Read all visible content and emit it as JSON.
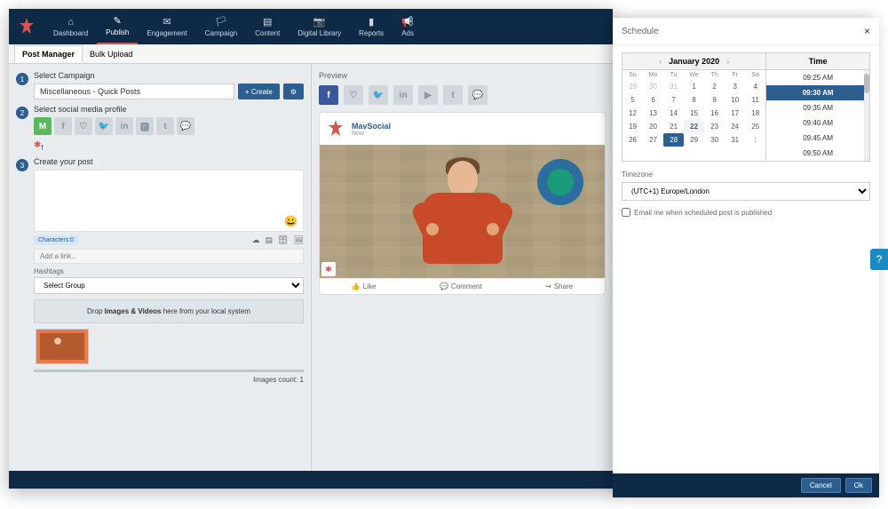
{
  "topnav": [
    {
      "label": "Dashboard",
      "icon": "⌂"
    },
    {
      "label": "Publish",
      "icon": "✎",
      "active": true
    },
    {
      "label": "Engagement",
      "icon": "✉"
    },
    {
      "label": "Campaign",
      "icon": "🏳"
    },
    {
      "label": "Content",
      "icon": "▤"
    },
    {
      "label": "Digital Library",
      "icon": "📷"
    },
    {
      "label": "Reports",
      "icon": "▮"
    },
    {
      "label": "Ads",
      "icon": "📢"
    }
  ],
  "subtabs": {
    "manager": "Post Manager",
    "bulk": "Bulk Upload"
  },
  "steps": {
    "s1": {
      "num": "1",
      "label": "Select Campaign",
      "value": "Miscellaneous - Quick Posts",
      "create": "+ Create"
    },
    "s2": {
      "num": "2",
      "label": "Select social media profile",
      "icons": [
        "M",
        "f",
        "♡",
        "🐦",
        "in",
        "🅿",
        "t",
        "💬"
      ]
    },
    "s3": {
      "num": "3",
      "label": "Create your post"
    }
  },
  "editor": {
    "chars": "Characters:0",
    "link_ph": "Add a link..",
    "hashtags": "Hashtags",
    "group": "Select Group"
  },
  "dropzone": {
    "pre": "Drop ",
    "bold": "Images & Videos",
    "post": " here from your local system"
  },
  "images_count": "Images count: 1",
  "preview": {
    "title": "Preview",
    "author": "MavSocial",
    "time": "Now",
    "like": "Like",
    "comment": "Comment",
    "share": "Share"
  },
  "scheduler": {
    "title": "Schedule",
    "month": "January 2020",
    "dow": [
      "Su",
      "Mo",
      "Tu",
      "We",
      "Th",
      "Fr",
      "Sa"
    ],
    "cal": [
      [
        {
          "d": "29",
          "o": 1
        },
        {
          "d": "30",
          "o": 1
        },
        {
          "d": "31",
          "o": 1
        },
        {
          "d": "1"
        },
        {
          "d": "2"
        },
        {
          "d": "3"
        },
        {
          "d": "4"
        }
      ],
      [
        {
          "d": "5"
        },
        {
          "d": "6"
        },
        {
          "d": "7"
        },
        {
          "d": "8"
        },
        {
          "d": "9"
        },
        {
          "d": "10"
        },
        {
          "d": "11"
        }
      ],
      [
        {
          "d": "12"
        },
        {
          "d": "13"
        },
        {
          "d": "14"
        },
        {
          "d": "15"
        },
        {
          "d": "16"
        },
        {
          "d": "17"
        },
        {
          "d": "18"
        }
      ],
      [
        {
          "d": "19"
        },
        {
          "d": "20"
        },
        {
          "d": "21"
        },
        {
          "d": "22",
          "t": 1
        },
        {
          "d": "23"
        },
        {
          "d": "24"
        },
        {
          "d": "25"
        }
      ],
      [
        {
          "d": "26"
        },
        {
          "d": "27"
        },
        {
          "d": "28",
          "s": 1
        },
        {
          "d": "29"
        },
        {
          "d": "30"
        },
        {
          "d": "31"
        },
        {
          "d": "1",
          "o": 1
        }
      ]
    ],
    "time_hdr": "Time",
    "times": [
      "09:25 AM",
      "09:30 AM",
      "09:35 AM",
      "09:40 AM",
      "09:45 AM",
      "09:50 AM"
    ],
    "time_sel": 1,
    "tz_label": "Timezone",
    "tz_value": "(UTC+1) Europe/London",
    "email": "Email me when scheduled post is published",
    "cancel": "Cancel",
    "ok": "Ok"
  }
}
